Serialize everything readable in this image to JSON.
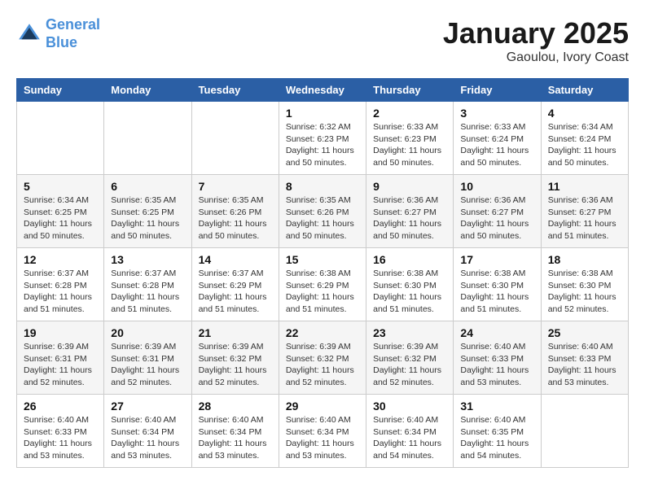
{
  "header": {
    "logo_line1": "General",
    "logo_line2": "Blue",
    "month_title": "January 2025",
    "location": "Gaoulou, Ivory Coast"
  },
  "weekdays": [
    "Sunday",
    "Monday",
    "Tuesday",
    "Wednesday",
    "Thursday",
    "Friday",
    "Saturday"
  ],
  "weeks": [
    [
      {
        "day": "",
        "info": ""
      },
      {
        "day": "",
        "info": ""
      },
      {
        "day": "",
        "info": ""
      },
      {
        "day": "1",
        "info": "Sunrise: 6:32 AM\nSunset: 6:23 PM\nDaylight: 11 hours\nand 50 minutes."
      },
      {
        "day": "2",
        "info": "Sunrise: 6:33 AM\nSunset: 6:23 PM\nDaylight: 11 hours\nand 50 minutes."
      },
      {
        "day": "3",
        "info": "Sunrise: 6:33 AM\nSunset: 6:24 PM\nDaylight: 11 hours\nand 50 minutes."
      },
      {
        "day": "4",
        "info": "Sunrise: 6:34 AM\nSunset: 6:24 PM\nDaylight: 11 hours\nand 50 minutes."
      }
    ],
    [
      {
        "day": "5",
        "info": "Sunrise: 6:34 AM\nSunset: 6:25 PM\nDaylight: 11 hours\nand 50 minutes."
      },
      {
        "day": "6",
        "info": "Sunrise: 6:35 AM\nSunset: 6:25 PM\nDaylight: 11 hours\nand 50 minutes."
      },
      {
        "day": "7",
        "info": "Sunrise: 6:35 AM\nSunset: 6:26 PM\nDaylight: 11 hours\nand 50 minutes."
      },
      {
        "day": "8",
        "info": "Sunrise: 6:35 AM\nSunset: 6:26 PM\nDaylight: 11 hours\nand 50 minutes."
      },
      {
        "day": "9",
        "info": "Sunrise: 6:36 AM\nSunset: 6:27 PM\nDaylight: 11 hours\nand 50 minutes."
      },
      {
        "day": "10",
        "info": "Sunrise: 6:36 AM\nSunset: 6:27 PM\nDaylight: 11 hours\nand 50 minutes."
      },
      {
        "day": "11",
        "info": "Sunrise: 6:36 AM\nSunset: 6:27 PM\nDaylight: 11 hours\nand 51 minutes."
      }
    ],
    [
      {
        "day": "12",
        "info": "Sunrise: 6:37 AM\nSunset: 6:28 PM\nDaylight: 11 hours\nand 51 minutes."
      },
      {
        "day": "13",
        "info": "Sunrise: 6:37 AM\nSunset: 6:28 PM\nDaylight: 11 hours\nand 51 minutes."
      },
      {
        "day": "14",
        "info": "Sunrise: 6:37 AM\nSunset: 6:29 PM\nDaylight: 11 hours\nand 51 minutes."
      },
      {
        "day": "15",
        "info": "Sunrise: 6:38 AM\nSunset: 6:29 PM\nDaylight: 11 hours\nand 51 minutes."
      },
      {
        "day": "16",
        "info": "Sunrise: 6:38 AM\nSunset: 6:30 PM\nDaylight: 11 hours\nand 51 minutes."
      },
      {
        "day": "17",
        "info": "Sunrise: 6:38 AM\nSunset: 6:30 PM\nDaylight: 11 hours\nand 51 minutes."
      },
      {
        "day": "18",
        "info": "Sunrise: 6:38 AM\nSunset: 6:30 PM\nDaylight: 11 hours\nand 52 minutes."
      }
    ],
    [
      {
        "day": "19",
        "info": "Sunrise: 6:39 AM\nSunset: 6:31 PM\nDaylight: 11 hours\nand 52 minutes."
      },
      {
        "day": "20",
        "info": "Sunrise: 6:39 AM\nSunset: 6:31 PM\nDaylight: 11 hours\nand 52 minutes."
      },
      {
        "day": "21",
        "info": "Sunrise: 6:39 AM\nSunset: 6:32 PM\nDaylight: 11 hours\nand 52 minutes."
      },
      {
        "day": "22",
        "info": "Sunrise: 6:39 AM\nSunset: 6:32 PM\nDaylight: 11 hours\nand 52 minutes."
      },
      {
        "day": "23",
        "info": "Sunrise: 6:39 AM\nSunset: 6:32 PM\nDaylight: 11 hours\nand 52 minutes."
      },
      {
        "day": "24",
        "info": "Sunrise: 6:40 AM\nSunset: 6:33 PM\nDaylight: 11 hours\nand 53 minutes."
      },
      {
        "day": "25",
        "info": "Sunrise: 6:40 AM\nSunset: 6:33 PM\nDaylight: 11 hours\nand 53 minutes."
      }
    ],
    [
      {
        "day": "26",
        "info": "Sunrise: 6:40 AM\nSunset: 6:33 PM\nDaylight: 11 hours\nand 53 minutes."
      },
      {
        "day": "27",
        "info": "Sunrise: 6:40 AM\nSunset: 6:34 PM\nDaylight: 11 hours\nand 53 minutes."
      },
      {
        "day": "28",
        "info": "Sunrise: 6:40 AM\nSunset: 6:34 PM\nDaylight: 11 hours\nand 53 minutes."
      },
      {
        "day": "29",
        "info": "Sunrise: 6:40 AM\nSunset: 6:34 PM\nDaylight: 11 hours\nand 53 minutes."
      },
      {
        "day": "30",
        "info": "Sunrise: 6:40 AM\nSunset: 6:34 PM\nDaylight: 11 hours\nand 54 minutes."
      },
      {
        "day": "31",
        "info": "Sunrise: 6:40 AM\nSunset: 6:35 PM\nDaylight: 11 hours\nand 54 minutes."
      },
      {
        "day": "",
        "info": ""
      }
    ]
  ]
}
